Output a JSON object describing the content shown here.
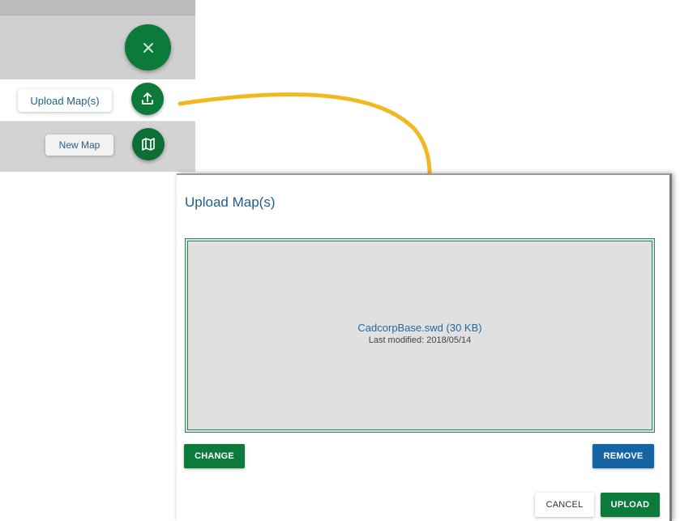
{
  "fab_menu": {
    "upload_label": "Upload Map(s)",
    "new_map_label": "New Map",
    "icons": {
      "close": "close-icon",
      "upload": "upload-icon",
      "new_map": "map-icon"
    },
    "accent_color": "#0b7a3b"
  },
  "dialog": {
    "title": "Upload Map(s)",
    "file": {
      "name": "CadcorpBase.swd (30 KB)",
      "last_modified": "Last modified: 2018/05/14"
    },
    "buttons": {
      "change": "CHANGE",
      "remove": "REMOVE",
      "cancel": "CANCEL",
      "upload": "UPLOAD"
    },
    "colors": {
      "primary_green": "#0b7a3b",
      "remove_blue": "#1565a5",
      "title_blue": "#1f5f8b"
    }
  },
  "annotation": {
    "arrow_color": "#f2b822"
  }
}
